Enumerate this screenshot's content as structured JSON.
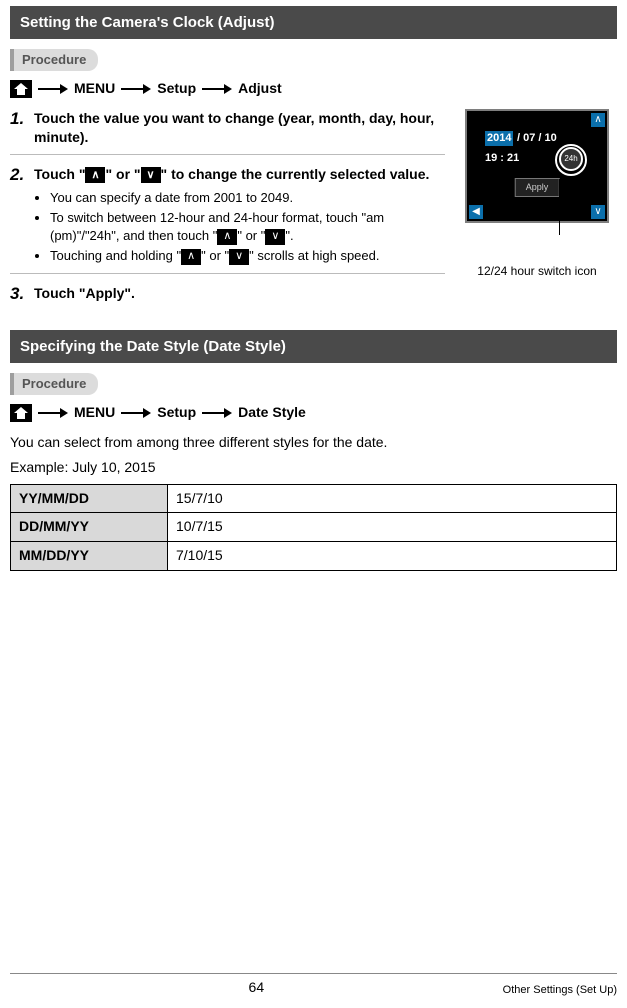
{
  "section1": {
    "title": "Setting the Camera's Clock (Adjust)",
    "procedure_label": "Procedure",
    "path": {
      "menu": "MENU",
      "setup": "Setup",
      "adjust": "Adjust"
    },
    "step1": {
      "num": "1.",
      "title": "Touch the value you want to change (year, month, day, hour, minute)."
    },
    "step2": {
      "num": "2.",
      "title_a": "Touch \"",
      "title_b": "\" or \"",
      "title_c": "\" to change the currently selected value.",
      "b1": "You can specify a date from 2001 to 2049.",
      "b2_a": "To switch between 12-hour and 24-hour format, touch \"am (pm)\"/\"24h\", and then touch \"",
      "b2_b": "\" or \"",
      "b2_c": "\".",
      "b3_a": "Touching and holding \"",
      "b3_b": "\" or \"",
      "b3_c": "\" scrolls at high speed."
    },
    "step3": {
      "num": "3.",
      "title": "Touch \"Apply\"."
    },
    "screenshot": {
      "year": "2014",
      "date_rest": "/  07  /  10",
      "time": "19  :  21",
      "switch": "24h",
      "apply": "Apply",
      "caption": "12/24 hour switch icon"
    }
  },
  "section2": {
    "title": "Specifying the Date Style (Date Style)",
    "procedure_label": "Procedure",
    "path": {
      "menu": "MENU",
      "setup": "Setup",
      "datestyle": "Date Style"
    },
    "desc": "You can select from among three different styles for the date.",
    "example": "Example: July 10, 2015",
    "rows": [
      {
        "h": "YY/MM/DD",
        "v": "15/7/10"
      },
      {
        "h": "DD/MM/YY",
        "v": "10/7/15"
      },
      {
        "h": "MM/DD/YY",
        "v": "7/10/15"
      }
    ]
  },
  "footer": {
    "page": "64",
    "section": "Other Settings (Set Up)"
  }
}
